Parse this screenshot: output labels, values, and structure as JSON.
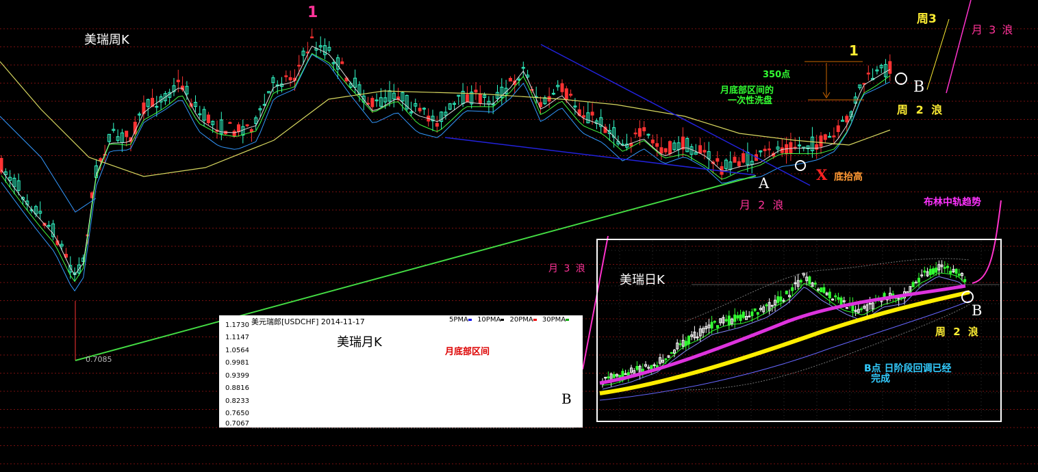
{
  "weekly": {
    "title": "美瑞周K",
    "wave_1_left": "1",
    "wave_1_right": "1",
    "week3": "周3",
    "month3": "月 3 浪",
    "points": "350点",
    "wash_line1": "月底部区间的",
    "wash_line2": "一次性洗盘",
    "point_b": "B",
    "week2": "周 2 浪",
    "x_mark": "X",
    "bottom_raise": "底抬高",
    "point_a": "A",
    "month2": "月 2 浪",
    "bollinger": "布林中轨趋势",
    "month3_mid": "月 3 浪",
    "low_price": "0.7085"
  },
  "monthly": {
    "header": "美元瑞郎[USDCHF] 2014-11-17",
    "legend": [
      {
        "label": "5PMA",
        "color": "#0000ee"
      },
      {
        "label": "10PMA",
        "color": "#000000"
      },
      {
        "label": "20PMA",
        "color": "#ee0000"
      },
      {
        "label": "30PMA",
        "color": "#00aa00"
      }
    ],
    "title": "美瑞月K",
    "range_label": "月底部区间",
    "point_b": "B",
    "yticks": [
      "1.1730",
      "1.1147",
      "1.0564",
      "0.9981",
      "0.9399",
      "0.8816",
      "0.8233",
      "0.7650",
      "0.7067"
    ]
  },
  "daily": {
    "title": "美瑞日K",
    "point_b": "B",
    "week2": "周 2 浪",
    "b_done_line1": "B点 日阶段回调已经",
    "b_done_line2": "完成"
  },
  "colors": {
    "up": "#33ffcc",
    "down": "#ff3333",
    "ma60": "#d8d860",
    "trendline": "#2222dd",
    "support": "#44dd44",
    "magenta": "#ff33cc",
    "bollinger_mid": "#ffee00"
  },
  "chart_data": [
    {
      "type": "candlestick",
      "title": "美瑞周K",
      "annotations": [
        "1",
        "1",
        "A",
        "B",
        "X",
        "350点"
      ],
      "low_label": 0.7085
    },
    {
      "type": "candlestick",
      "title": "美瑞月K",
      "ylim": [
        0.7067,
        1.173
      ],
      "yticks": [
        1.173,
        1.1147,
        1.0564,
        0.9981,
        0.9399,
        0.8816,
        0.8233,
        0.765,
        0.7067
      ],
      "series": [
        {
          "name": "5PMA"
        },
        {
          "name": "10PMA"
        },
        {
          "name": "20PMA"
        },
        {
          "name": "30PMA"
        }
      ]
    },
    {
      "type": "candlestick",
      "title": "美瑞日K",
      "annotations": [
        "B"
      ]
    }
  ]
}
